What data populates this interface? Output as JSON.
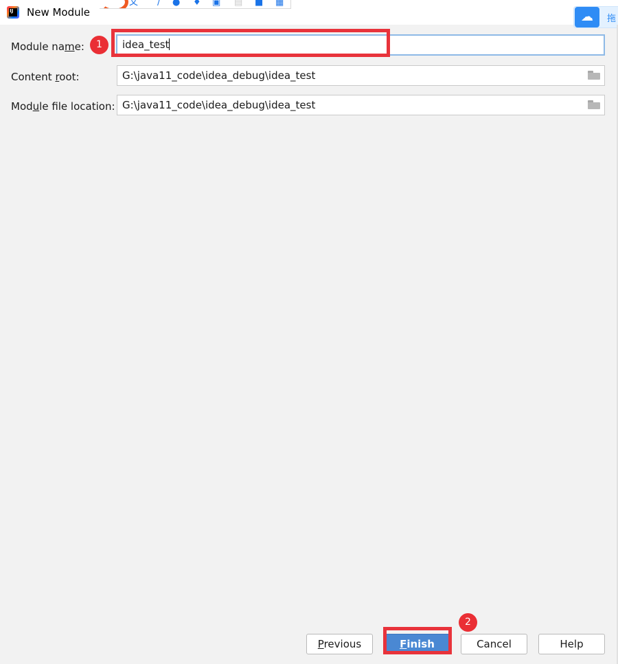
{
  "window": {
    "title": "New Module"
  },
  "overlay_toolbar": {
    "icons": [
      "translate-icon",
      "pen-icon",
      "circle-icon",
      "bulb-icon",
      "window-icon",
      "copy-icon",
      "bookmark-icon",
      "grid-icon"
    ]
  },
  "cloud_widget": {
    "icon": "cloud-icon",
    "text": "拖"
  },
  "form": {
    "module_name": {
      "label_before": "Module na",
      "label_mnemonic": "m",
      "label_after": "e:",
      "value": "idea_test"
    },
    "content_root": {
      "label_before": "Content ",
      "label_mnemonic": "r",
      "label_after": "oot:",
      "value": "G:\\java11_code\\idea_debug\\idea_test"
    },
    "module_file_location": {
      "label_before": "Mod",
      "label_mnemonic": "u",
      "label_after": "le file location:",
      "value": "G:\\java11_code\\idea_debug\\idea_test"
    }
  },
  "annotations": {
    "step1": "1",
    "step2": "2"
  },
  "buttons": {
    "previous": {
      "mnemonic": "P",
      "rest": "revious"
    },
    "finish": {
      "mnemonic": "F",
      "rest": "inish"
    },
    "cancel": {
      "label": "Cancel"
    },
    "help": {
      "label": "Help"
    }
  },
  "colors": {
    "accent": "#4a88d3",
    "annotation_red": "#e8333b",
    "focus_border": "#8db9e6",
    "background": "#f2f2f2"
  }
}
